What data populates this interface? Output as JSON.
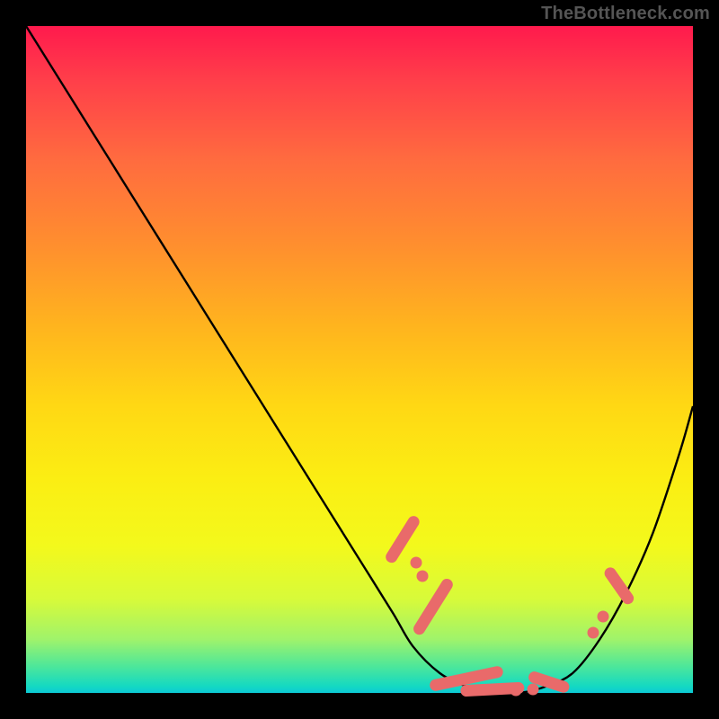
{
  "watermark": "TheBottleneck.com",
  "colors": {
    "frame_bg": "#000000",
    "marker": "#e96a6a",
    "curve": "#000000"
  },
  "chart_data": {
    "type": "line",
    "title": "",
    "xlabel": "",
    "ylabel": "",
    "xlim": [
      0,
      100
    ],
    "ylim": [
      0,
      100
    ],
    "grid": false,
    "legend": false,
    "note": "Axes have no visible tick labels; x and y are read as 0–100 percent of plot width/height. y is the curve height above the bottom (0 = bottom green band, 100 = top).",
    "series": [
      {
        "name": "bottleneck-curve",
        "x": [
          0,
          5,
          10,
          15,
          20,
          25,
          30,
          35,
          40,
          45,
          50,
          55,
          58,
          62,
          66,
          70,
          74,
          78,
          82,
          86,
          90,
          94,
          98,
          100
        ],
        "y": [
          100,
          92,
          84,
          76,
          68,
          60,
          52,
          44,
          36,
          28,
          20,
          12,
          7,
          3,
          1,
          0,
          0,
          1,
          3,
          8,
          15,
          24,
          36,
          43
        ]
      }
    ],
    "markers": {
      "note": "Salmon dots/pills mark regions on the curve; positions given as (x%, y%) in plot coords, with optional pill length along the curve direction.",
      "points": [
        {
          "x": 56.5,
          "y": 23.0,
          "shape": "pill",
          "len": 5.0,
          "angle_deg": -58
        },
        {
          "x": 58.5,
          "y": 19.5,
          "shape": "dot"
        },
        {
          "x": 59.5,
          "y": 17.5,
          "shape": "dot"
        },
        {
          "x": 61.0,
          "y": 13.0,
          "shape": "pill",
          "len": 6.0,
          "angle_deg": -58
        },
        {
          "x": 66.0,
          "y": 2.2,
          "shape": "pill",
          "len": 7.0,
          "angle_deg": -12
        },
        {
          "x": 70.0,
          "y": 0.6,
          "shape": "pill",
          "len": 6.0,
          "angle_deg": -3
        },
        {
          "x": 73.5,
          "y": 0.4,
          "shape": "dot"
        },
        {
          "x": 76.0,
          "y": 0.6,
          "shape": "dot"
        },
        {
          "x": 78.5,
          "y": 1.6,
          "shape": "pill",
          "len": 4.0,
          "angle_deg": 18
        },
        {
          "x": 85.0,
          "y": 9.0,
          "shape": "dot"
        },
        {
          "x": 86.5,
          "y": 11.5,
          "shape": "dot"
        },
        {
          "x": 89.0,
          "y": 16.0,
          "shape": "pill",
          "len": 4.0,
          "angle_deg": 55
        }
      ]
    }
  }
}
